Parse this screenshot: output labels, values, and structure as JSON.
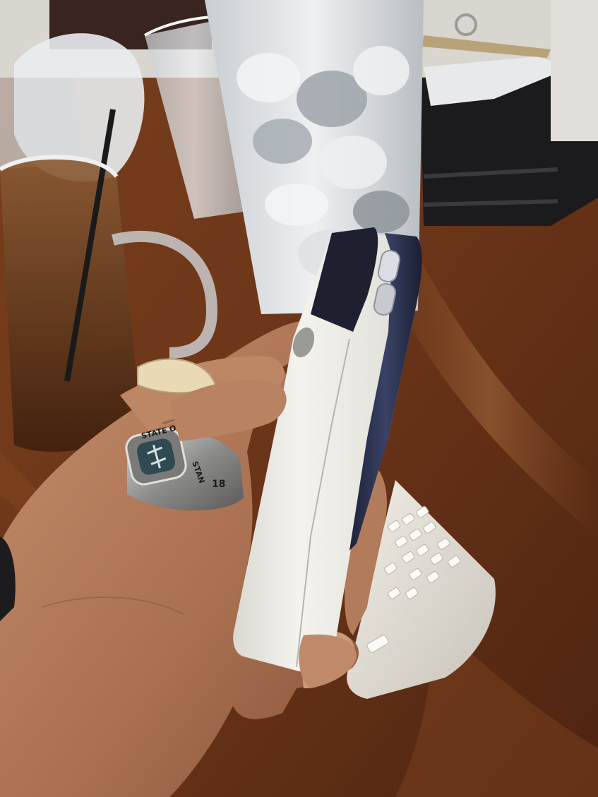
{
  "photo": {
    "subject": "hand holding a white and navy mobile phone",
    "ring_engraving": [
      "STATE OF TEX",
      "STAN",
      "18"
    ],
    "colors": {
      "table": "#6b3519",
      "table_highlight": "#9a5a2e",
      "phone_body": "#ecebe4",
      "phone_navy": "#2b3150",
      "skin": "#b07a5c",
      "ring_silver": "#9c9c9a",
      "ring_stone": "#2f4a52",
      "ice_glass": "#d9dde0",
      "coffee": "#6a3a18",
      "blackberry_body": "#e7e3da"
    }
  }
}
